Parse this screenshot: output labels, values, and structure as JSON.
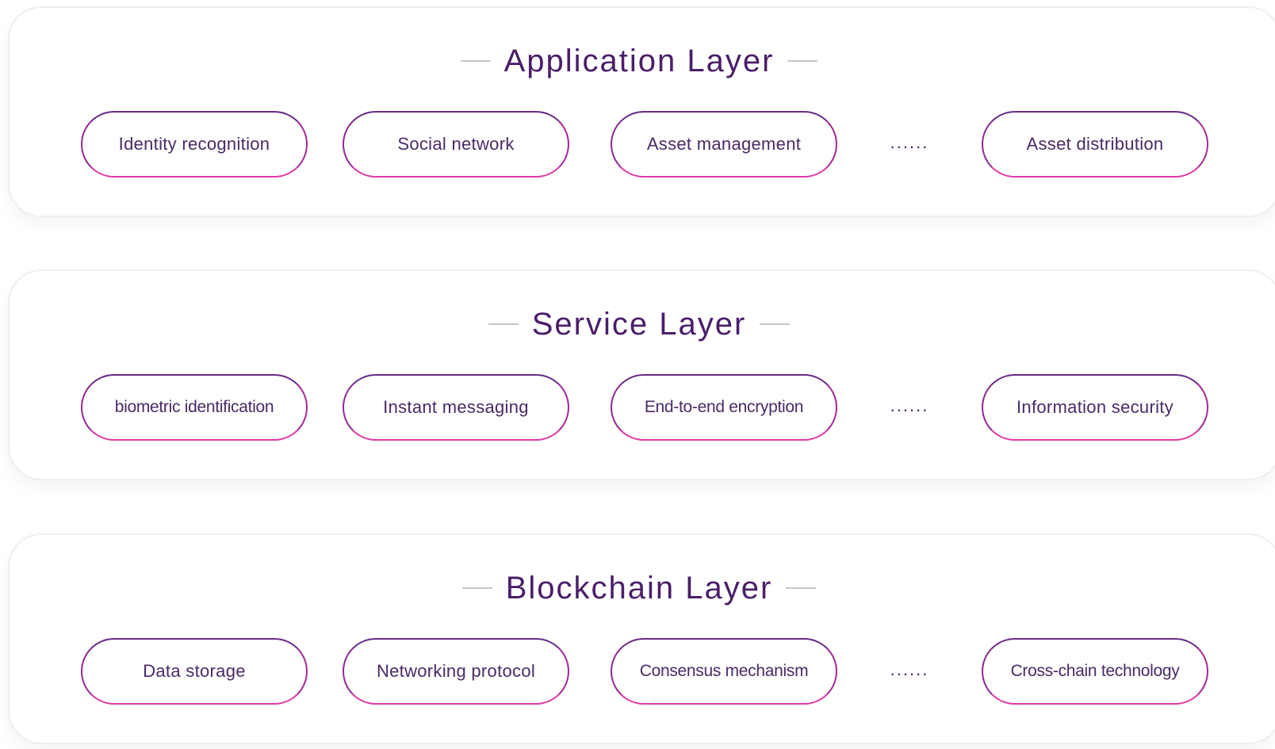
{
  "layers": [
    {
      "title": "Application Layer",
      "items": [
        "Identity recognition",
        "Social network",
        "Asset management",
        "Asset distribution"
      ],
      "ellipsis": "......"
    },
    {
      "title": "Service Layer",
      "items": [
        "biometric identification",
        "Instant messaging",
        "End-to-end encryption",
        "Information security"
      ],
      "ellipsis": "......"
    },
    {
      "title": "Blockchain Layer",
      "items": [
        "Data storage",
        "Networking protocol",
        "Consensus mechanism",
        "Cross-chain technology"
      ],
      "ellipsis": "......"
    }
  ],
  "colors": {
    "title": "#4a1e6a",
    "pill_border_top": "#6a2a86",
    "pill_border_bottom": "#e03aa6",
    "card_border": "#f0eef2",
    "dash": "#c9c6ce"
  }
}
